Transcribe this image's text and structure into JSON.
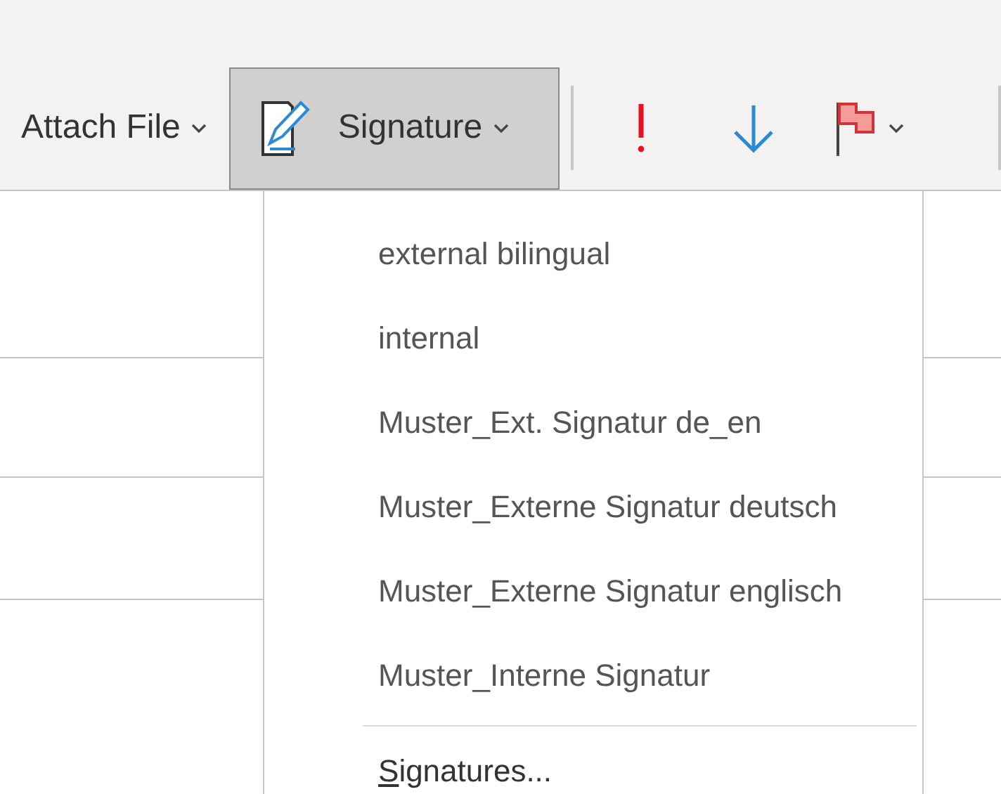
{
  "toolbar": {
    "attach_file": {
      "label": "Attach File"
    },
    "signature": {
      "label": "Signature",
      "expanded": true
    }
  },
  "menu": {
    "items": [
      {
        "label": "external bilingual"
      },
      {
        "label": "internal"
      },
      {
        "label": "Muster_Ext. Signatur de_en"
      },
      {
        "label": "Muster_Externe Signatur deutsch"
      },
      {
        "label": "Muster_Externe Signatur englisch"
      },
      {
        "label": "Muster_Interne Signatur"
      }
    ],
    "footer": {
      "label": "Signatures...",
      "access_key_underlined": true
    }
  }
}
